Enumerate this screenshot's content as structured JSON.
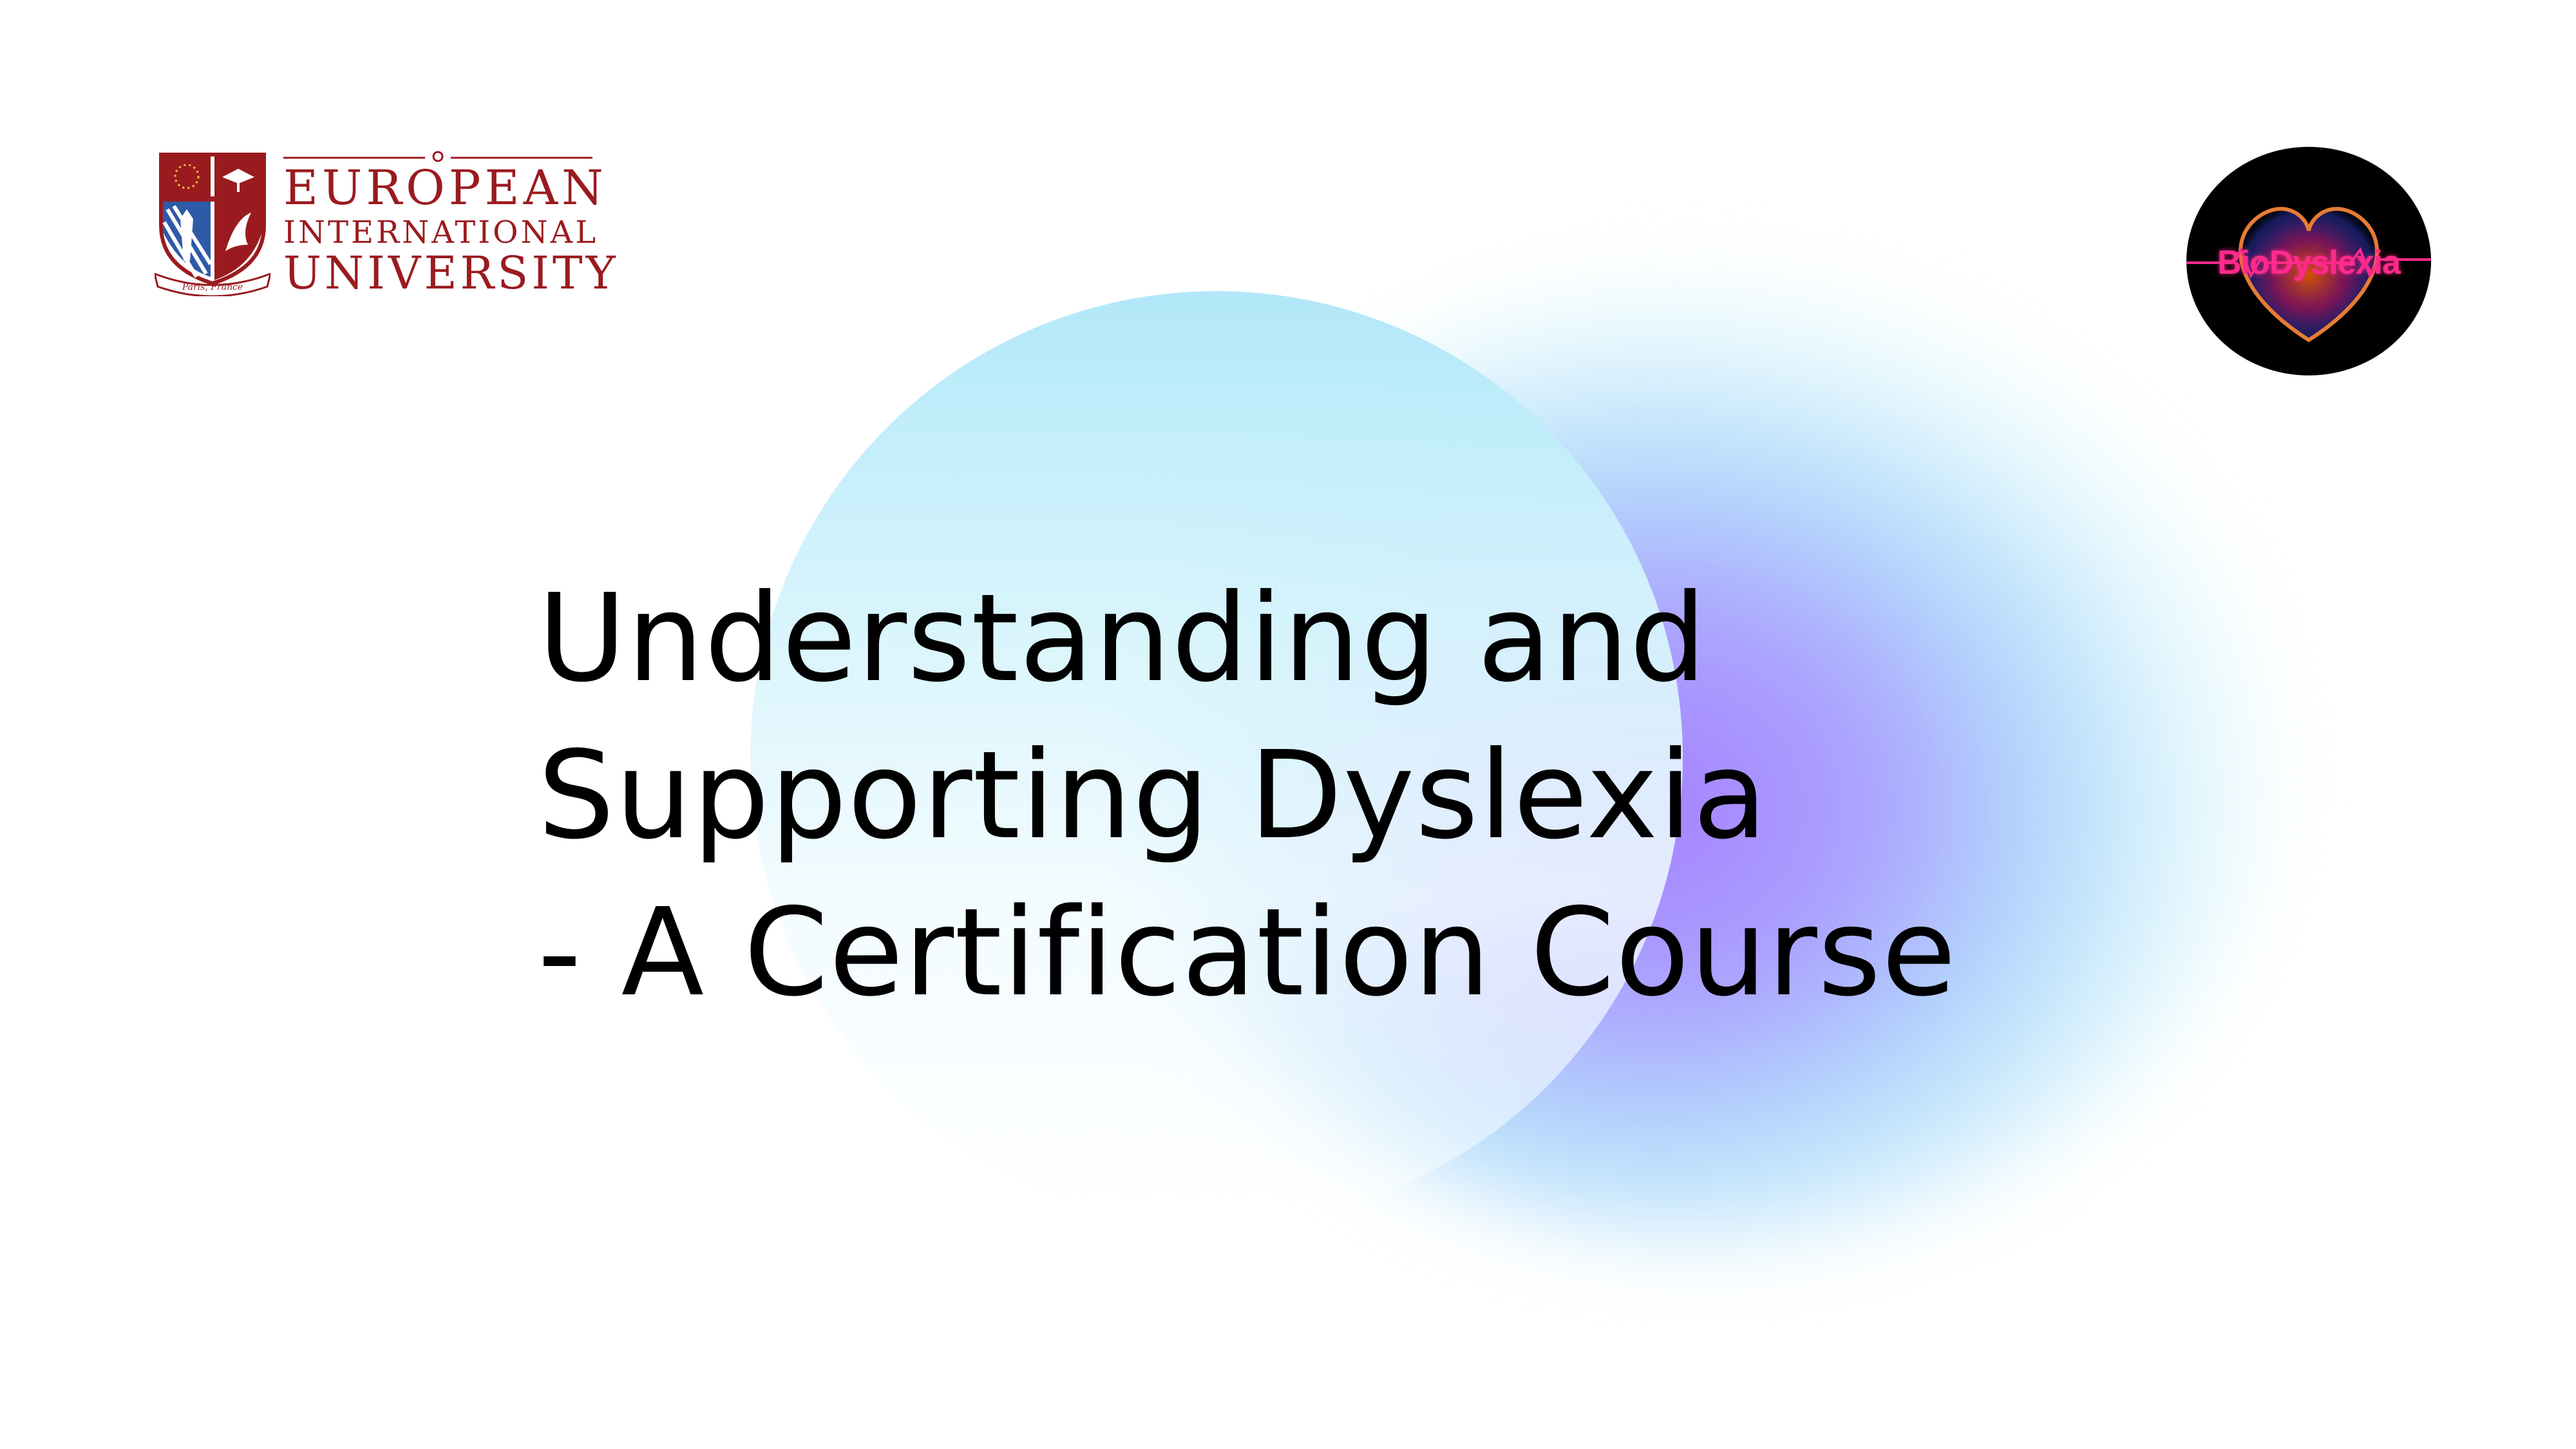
{
  "slide": {
    "title_lines": [
      "Understanding and",
      "Supporting Dyslexia",
      "- A Certification Course"
    ]
  },
  "logos": {
    "university": {
      "line1": "EUROPEAN",
      "line2": "INTERNATIONAL",
      "line3": "UNIVERSITY",
      "motto": "Paris, France",
      "color": "#9a1b1f"
    },
    "brand": {
      "text": "BioDyslexia",
      "color": "#ff2a8c"
    }
  },
  "colors": {
    "background": "#ffffff",
    "title": "#000000",
    "circle_top": "#b2e8f9",
    "blob_purple": "#a078ff",
    "blob_blue": "#8cc8fa"
  }
}
